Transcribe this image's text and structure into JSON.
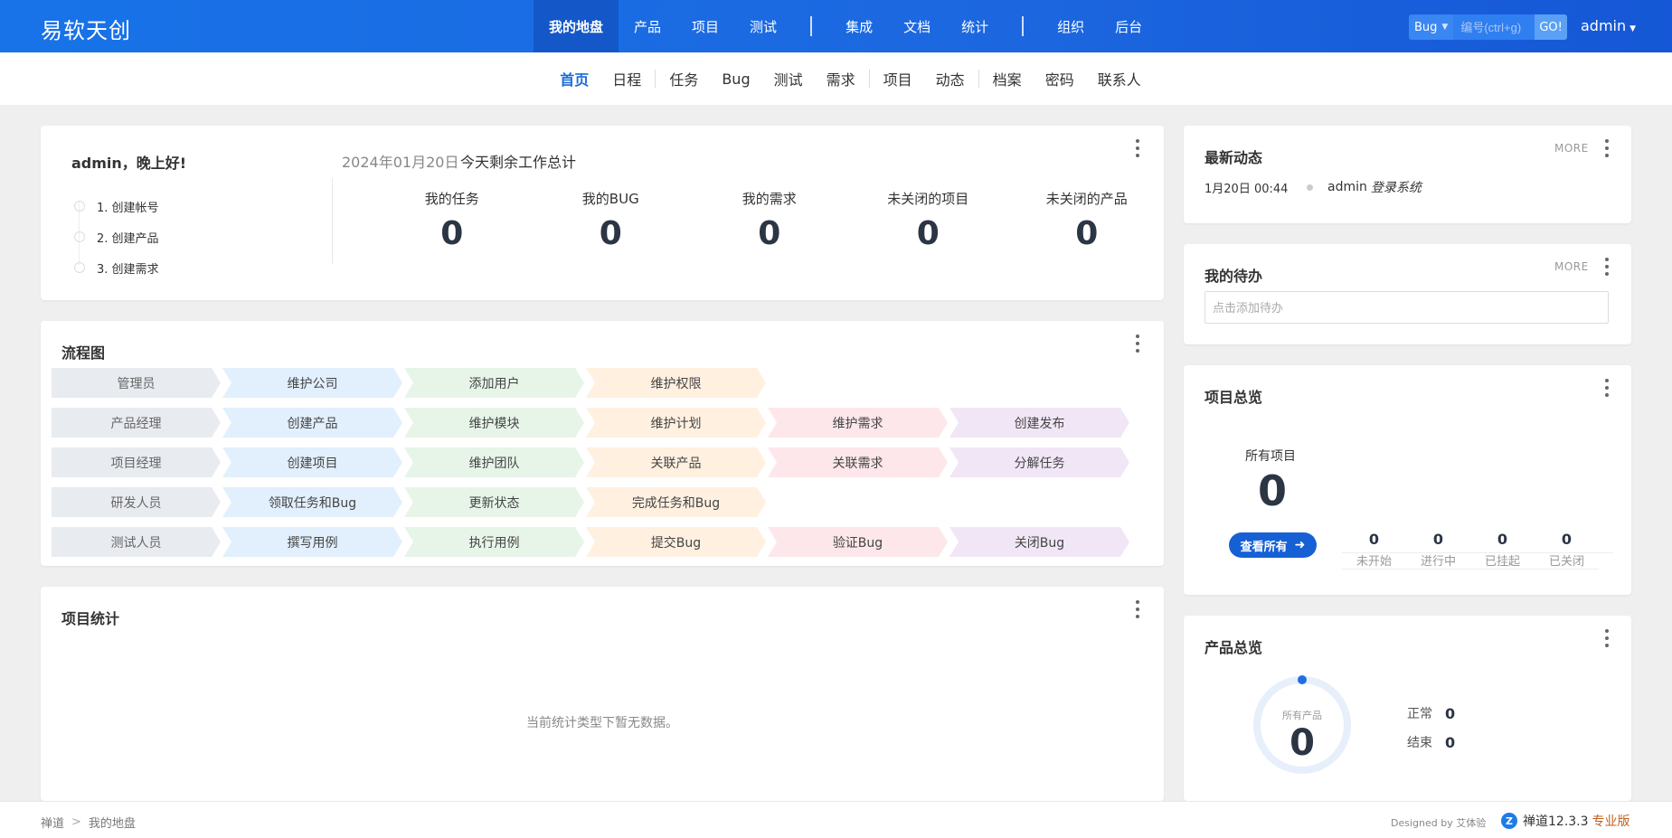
{
  "header": {
    "brand": "易软天创",
    "nav": [
      {
        "label": "我的地盘",
        "active": true
      },
      {
        "label": "产品"
      },
      {
        "label": "项目"
      },
      {
        "label": "测试"
      },
      {
        "label": "集成"
      },
      {
        "label": "文档"
      },
      {
        "label": "统计"
      },
      {
        "label": "组织"
      },
      {
        "label": "后台"
      }
    ],
    "search": {
      "type": "Bug",
      "placeholder": "编号(ctrl+g)",
      "go": "GO!"
    },
    "user": "admin"
  },
  "subnav": [
    "首页",
    "日程",
    "任务",
    "Bug",
    "测试",
    "需求",
    "项目",
    "动态",
    "档案",
    "密码",
    "联系人"
  ],
  "welcome": {
    "greeting": "admin，晚上好!",
    "steps": [
      "1. 创建帐号",
      "2. 创建产品",
      "3. 创建需求"
    ],
    "date": "2024年01月20日",
    "summary": "今天剩余工作总计",
    "stats": [
      {
        "label": "我的任务",
        "value": "0"
      },
      {
        "label": "我的BUG",
        "value": "0"
      },
      {
        "label": "我的需求",
        "value": "0"
      },
      {
        "label": "未关闭的项目",
        "value": "0"
      },
      {
        "label": "未关闭的产品",
        "value": "0"
      }
    ]
  },
  "flow": {
    "title": "流程图",
    "rows": [
      {
        "role": "管理员",
        "steps": [
          "维护公司",
          "添加用户",
          "维护权限"
        ]
      },
      {
        "role": "产品经理",
        "steps": [
          "创建产品",
          "维护模块",
          "维护计划",
          "维护需求",
          "创建发布"
        ]
      },
      {
        "role": "项目经理",
        "steps": [
          "创建项目",
          "维护团队",
          "关联产品",
          "关联需求",
          "分解任务"
        ]
      },
      {
        "role": "研发人员",
        "steps": [
          "领取任务和Bug",
          "更新状态",
          "完成任务和Bug"
        ]
      },
      {
        "role": "测试人员",
        "steps": [
          "撰写用例",
          "执行用例",
          "提交Bug",
          "验证Bug",
          "关闭Bug"
        ]
      }
    ]
  },
  "projstats": {
    "title": "项目统计",
    "empty": "当前统计类型下暂无数据。"
  },
  "dynamics": {
    "title": "最新动态",
    "more": "MORE",
    "items": [
      {
        "time": "1月20日 00:44",
        "user": "admin",
        "action": "登录系统"
      }
    ]
  },
  "todo": {
    "title": "我的待办",
    "more": "MORE",
    "placeholder": "点击添加待办"
  },
  "project_overview": {
    "title": "项目总览",
    "label": "所有项目",
    "total": "0",
    "button": "查看所有",
    "mini": [
      {
        "value": "0",
        "label": "未开始"
      },
      {
        "value": "0",
        "label": "进行中"
      },
      {
        "value": "0",
        "label": "已挂起"
      },
      {
        "value": "0",
        "label": "已关闭"
      }
    ]
  },
  "product_overview": {
    "title": "产品总览",
    "ring_label": "所有产品",
    "total": "0",
    "legend": [
      {
        "label": "正常",
        "value": "0"
      },
      {
        "label": "结束",
        "value": "0"
      }
    ]
  },
  "footer": {
    "crumbs": [
      "禅道",
      "我的地盘"
    ],
    "design": "Designed by 艾体验",
    "version": "禅道12.3.3",
    "version_extra": "专业版"
  },
  "colors": {
    "primary": "#1b6bd8",
    "header": "#1873e8",
    "ring": "#e6effa",
    "ring_dot": "#1e6fe0"
  }
}
